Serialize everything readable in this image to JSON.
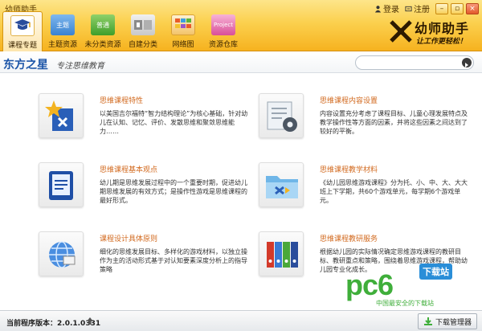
{
  "window": {
    "title": "幼师助手",
    "login": "登录",
    "register": "注册",
    "min_label": "–",
    "max_label": "▫",
    "close_label": "×"
  },
  "tabs": [
    {
      "label": "课程专题",
      "icon": "course-topic-icon",
      "active": true,
      "badge": ""
    },
    {
      "label": "主题资源",
      "icon": "theme-resource-icon",
      "active": false,
      "badge": "主题"
    },
    {
      "label": "未分类资源",
      "icon": "uncategorized-resource-icon",
      "active": false,
      "badge": "普通"
    },
    {
      "label": "自建分类",
      "icon": "custom-category-icon",
      "active": false,
      "badge": ""
    },
    {
      "label": "网络图",
      "icon": "network-image-icon",
      "active": false,
      "badge": ""
    },
    {
      "label": "资源仓库",
      "icon": "resource-warehouse-icon",
      "active": false,
      "badge": "Project"
    }
  ],
  "logo": {
    "main": "幼师助手",
    "sub": "让工作更轻松！"
  },
  "subheader": {
    "brand": "东方之星",
    "slogan": "专注思维教育",
    "search_placeholder": ""
  },
  "cards": [
    {
      "title": "思维课程特性",
      "desc": "以美国吉尔福特“智力结构理论”为核心基础，针对幼儿在认知、记忆、评价、发散思维和聚敛思维能力……",
      "icon": "star-icon"
    },
    {
      "title": "思维课程内容设置",
      "desc": "内容设置充分考虑了课程目标、儿童心理发展特点及教学操作性等方面的因素，并将这些因素之间达到了较好的平衡。",
      "icon": "gear-icon"
    },
    {
      "title": "思维课程基本观点",
      "desc": "幼儿期是思维发展过程中的一个重要时期，促进幼儿期思维发展的有效方式；是操作性游戏是思维课程的最好形式。",
      "icon": "book-icon"
    },
    {
      "title": "思维课程教学材料",
      "desc": "《幼儿园思维游戏课程》分为托、小、中、大、大大班上下学期，共60个游戏单元，每学期6个游戏单元。",
      "icon": "folder-icon"
    },
    {
      "title": "课程设计具体原则",
      "desc": "细化的思维发展目标、多样化的游戏材料，以独立操作为主的活动形式基于对认知要素深度分析上的指导策略",
      "icon": "globe-icon"
    },
    {
      "title": "思维课程教研服务",
      "desc": "根据幼儿园的实际情况确定思维游戏课程的教研目标、教研重点和策略，围绕着思维游戏课程，帮助幼儿园专业化成长。",
      "icon": "binders-icon"
    }
  ],
  "footer": {
    "version_label": "当前程序版本：",
    "version": "2.0.1.0331",
    "download_manager": "下载管理器"
  },
  "watermark": {
    "big": "pc6",
    "badge": "下载站",
    "sub": "中国最安全的下载站"
  },
  "colors": {
    "accent": "#f6b21f",
    "title": "#d2691e",
    "brand": "#1c55a8",
    "watermark": "#3fae3a"
  }
}
